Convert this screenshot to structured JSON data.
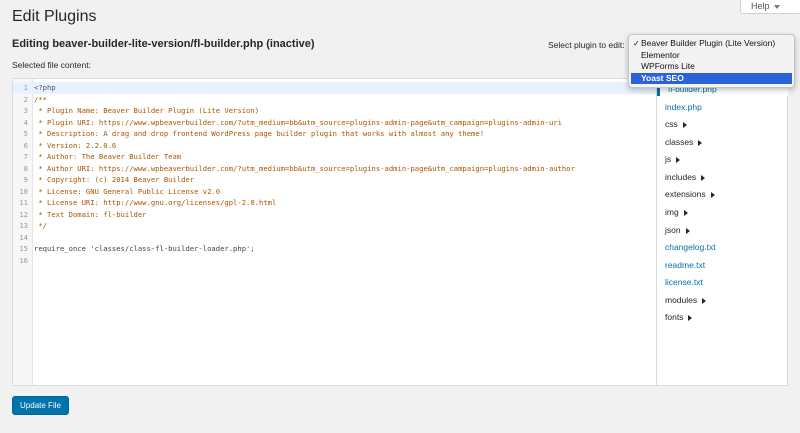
{
  "page": {
    "title": "Edit Plugins"
  },
  "help": {
    "label": "Help"
  },
  "editing": {
    "heading": "Editing beaver-builder-lite-version/fl-builder.php (inactive)",
    "select_label": "Select plugin to edit:",
    "file_content_label": "Selected file content:"
  },
  "dropdown": {
    "options": [
      {
        "label": "Beaver Builder Plugin (Lite Version)",
        "checked": true
      },
      {
        "label": "Elementor"
      },
      {
        "label": "WPForms Lite"
      },
      {
        "label": "Yoast SEO",
        "highlighted": true
      }
    ]
  },
  "code": {
    "lines": [
      {
        "n": "1",
        "text": "<?php"
      },
      {
        "n": "2",
        "text": "/**"
      },
      {
        "n": "3",
        "text": " * Plugin Name: Beaver Builder Plugin (Lite Version)"
      },
      {
        "n": "4",
        "text": " * Plugin URI: https://www.wpbeaverbuilder.com/?utm_medium=bb&utm_source=plugins-admin-page&utm_campaign=plugins-admin-uri"
      },
      {
        "n": "5",
        "text": " * Description: A drag and drop frontend WordPress page builder plugin that works with almost any theme!"
      },
      {
        "n": "6",
        "text": " * Version: 2.2.0.6"
      },
      {
        "n": "7",
        "text": " * Author: The Beaver Builder Team"
      },
      {
        "n": "8",
        "text": " * Author URI: https://www.wpbeaverbuilder.com/?utm_medium=bb&utm_source=plugins-admin-page&utm_campaign=plugins-admin-author"
      },
      {
        "n": "9",
        "text": " * Copyright: (c) 2014 Beaver Builder"
      },
      {
        "n": "10",
        "text": " * License: GNU General Public License v2.0"
      },
      {
        "n": "11",
        "text": " * License URI: http://www.gnu.org/licenses/gpl-2.0.html"
      },
      {
        "n": "12",
        "text": " * Text Domain: fl-builder"
      },
      {
        "n": "13",
        "text": " */"
      },
      {
        "n": "14",
        "text": ""
      },
      {
        "n": "15",
        "text": "require_once 'classes/class-fl-builder-loader.php';"
      },
      {
        "n": "16",
        "text": ""
      }
    ]
  },
  "files": {
    "items": [
      {
        "label": "fl-builder.php",
        "type": "file"
      },
      {
        "label": "index.php",
        "type": "file"
      },
      {
        "label": "css",
        "type": "dir"
      },
      {
        "label": "classes",
        "type": "dir"
      },
      {
        "label": "js",
        "type": "dir"
      },
      {
        "label": "includes",
        "type": "dir"
      },
      {
        "label": "extensions",
        "type": "dir"
      },
      {
        "label": "img",
        "type": "dir"
      },
      {
        "label": "json",
        "type": "dir"
      },
      {
        "label": "changelog.txt",
        "type": "file"
      },
      {
        "label": "readme.txt",
        "type": "file"
      },
      {
        "label": "license.txt",
        "type": "file"
      },
      {
        "label": "modules",
        "type": "dir"
      },
      {
        "label": "fonts",
        "type": "dir"
      }
    ]
  },
  "actions": {
    "update_label": "Update File"
  },
  "colors": {
    "accent": "#0073aa",
    "highlight": "#2a62d9",
    "comment": "#aa5500"
  }
}
